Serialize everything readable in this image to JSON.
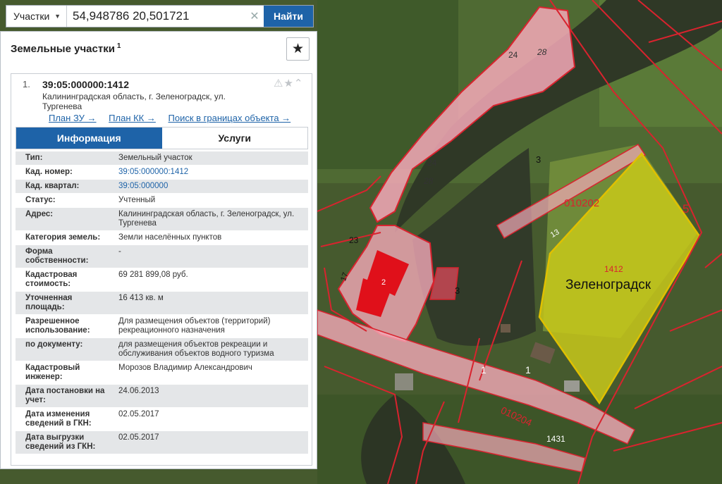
{
  "search": {
    "layer": "Участки",
    "query": "54,948786 20,501721",
    "button": "Найти"
  },
  "panel": {
    "title": "Земельные участки",
    "title_sup": "1"
  },
  "card": {
    "number": "1.",
    "cadastral": "39:05:000000:1412",
    "address": "Калининградская область, г. Зеленоградск, ул. Тургенева",
    "links": [
      "План ЗУ →",
      "План КК →",
      "Поиск в границах объекта →"
    ],
    "tabs": [
      "Информация",
      "Услуги"
    ]
  },
  "info": [
    {
      "k": "Тип:",
      "v": "Земельный участок"
    },
    {
      "k": "Кад. номер:",
      "v": "39:05:000000:1412",
      "link": true
    },
    {
      "k": "Кад. квартал:",
      "v": "39:05:000000",
      "link": true
    },
    {
      "k": "Статус:",
      "v": "Учтенный"
    },
    {
      "k": "Адрес:",
      "v": "Калининградская область, г. Зеленоградск, ул. Тургенева"
    },
    {
      "k": "Категория земель:",
      "v": "Земли населённых пунктов"
    },
    {
      "k": "Форма собственности:",
      "v": "-"
    },
    {
      "k": "Кадастровая стоимость:",
      "v": "69 281 899,08 руб."
    },
    {
      "k": "Уточненная площадь:",
      "v": "16 413 кв. м"
    },
    {
      "k": "Разрешенное использование:",
      "v": "Для размещения объектов (территорий) рекреационного назначения"
    },
    {
      "k": "по документу:",
      "v": "для размещения объектов рекреации и обслуживания объектов водного туризма"
    },
    {
      "k": "Кадастровый инженер:",
      "v": "Морозов Владимир Александрович"
    },
    {
      "k": "Дата постановки на учет:",
      "v": "24.06.2013"
    },
    {
      "k": "Дата изменения сведений в ГКН:",
      "v": "02.05.2017"
    },
    {
      "k": "Дата выгрузки сведений из ГКН:",
      "v": "02.05.2017"
    }
  ],
  "map": {
    "town": "Зеленоградск",
    "parcel": "1412",
    "quarter_top": "010202",
    "quarter_bottom": "010204",
    "road_label": "1431",
    "labels": [
      "24",
      "28",
      "24",
      "28",
      "3",
      "3",
      "23",
      "17",
      "2",
      "1",
      "1",
      "13",
      "5"
    ],
    "colors": {
      "selected_fill": "#c8c81a",
      "selected_stroke": "#e0c000",
      "parcel_fill": "#f4a9b8",
      "border": "#d9232e",
      "accent": "#1e63a8"
    }
  }
}
